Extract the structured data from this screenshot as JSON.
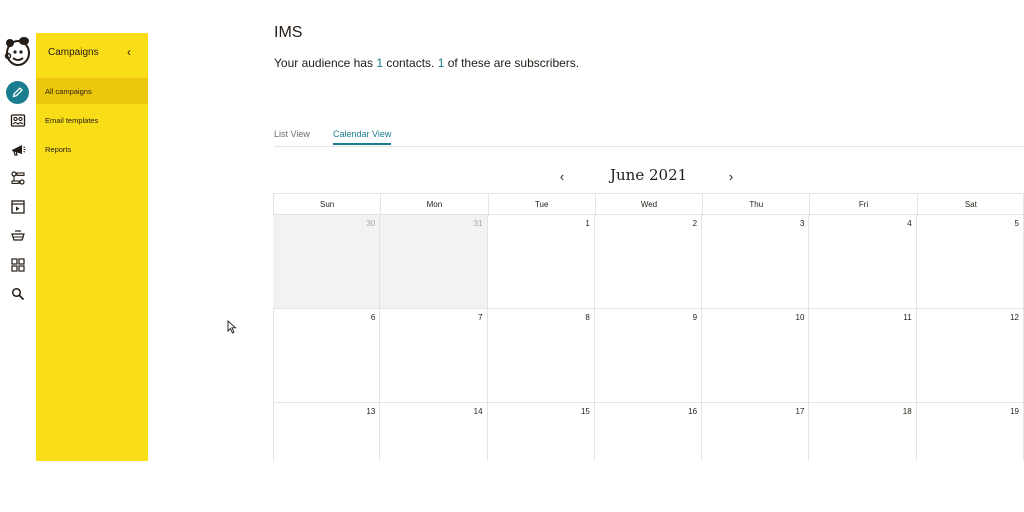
{
  "colors": {
    "accent": "#1a7d8f",
    "sidebar": "#f9dd17",
    "sidebar_active": "#ecc70c",
    "text": "#241c15"
  },
  "rail": {
    "icons": [
      {
        "name": "create-icon",
        "active": true
      },
      {
        "name": "audience-icon",
        "active": false
      },
      {
        "name": "campaigns-icon",
        "active": false
      },
      {
        "name": "automations-icon",
        "active": false
      },
      {
        "name": "website-icon",
        "active": false
      },
      {
        "name": "content-icon",
        "active": false
      },
      {
        "name": "integrations-icon",
        "active": false
      },
      {
        "name": "search-icon",
        "active": false
      }
    ]
  },
  "sidebar": {
    "title": "Campaigns",
    "collapse_icon": "chevron-left-icon",
    "items": [
      {
        "label": "All campaigns",
        "active": true
      },
      {
        "label": "Email templates",
        "active": false
      },
      {
        "label": "Reports",
        "active": false
      }
    ]
  },
  "main": {
    "title": "IMS",
    "audience": {
      "prefix": "Your audience has ",
      "contacts": "1",
      "middle": " contacts. ",
      "subscribers": "1",
      "suffix": " of these are subscribers."
    },
    "tabs": [
      {
        "label": "List View",
        "active": false
      },
      {
        "label": "Calendar View",
        "active": true
      }
    ]
  },
  "calendar": {
    "month_label": "June 2021",
    "prev_icon": "chevron-left-icon",
    "next_icon": "chevron-right-icon",
    "weekdays": [
      "Sun",
      "Mon",
      "Tue",
      "Wed",
      "Thu",
      "Fri",
      "Sat"
    ],
    "weeks": [
      [
        {
          "d": "30",
          "other": true
        },
        {
          "d": "31",
          "other": true
        },
        {
          "d": "1"
        },
        {
          "d": "2"
        },
        {
          "d": "3"
        },
        {
          "d": "4"
        },
        {
          "d": "5"
        }
      ],
      [
        {
          "d": "6"
        },
        {
          "d": "7"
        },
        {
          "d": "8"
        },
        {
          "d": "9"
        },
        {
          "d": "10"
        },
        {
          "d": "11"
        },
        {
          "d": "12"
        }
      ],
      [
        {
          "d": "13"
        },
        {
          "d": "14"
        },
        {
          "d": "15"
        },
        {
          "d": "16"
        },
        {
          "d": "17"
        },
        {
          "d": "18"
        },
        {
          "d": "19"
        }
      ]
    ]
  }
}
